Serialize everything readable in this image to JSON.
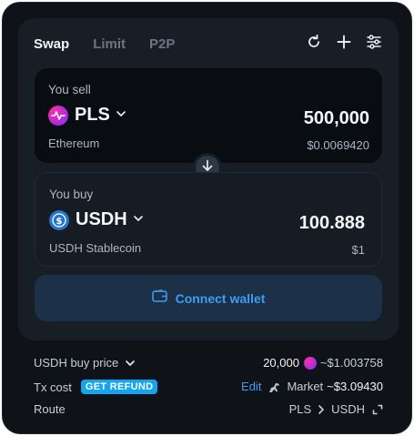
{
  "tabs": [
    {
      "label": "Swap"
    },
    {
      "label": "Limit"
    },
    {
      "label": "P2P"
    }
  ],
  "tool_icons": [
    "refresh-icon",
    "plus-icon",
    "sliders-icon"
  ],
  "sell": {
    "label": "You sell",
    "token": "PLS",
    "amount": "500,000",
    "chain": "Ethereum",
    "usd": "$0.0069420"
  },
  "buy": {
    "label": "You buy",
    "token": "USDH",
    "amount": "100.888",
    "chain": "USDH Stablecoin",
    "usd": "$1"
  },
  "connect_label": "Connect wallet",
  "info": {
    "price_label": "USDH buy price",
    "price_amount": "20,000",
    "price_usd": "~$1.003758",
    "tx_label": "Tx cost",
    "refund_label": "GET REFUND",
    "edit_label": "Edit",
    "mode_label": "Market",
    "tx_value": "~$3.09430",
    "route_label": "Route",
    "route_from": "PLS",
    "route_to": "USDH"
  },
  "colors": {
    "accent": "#3f9cf0",
    "refund_badge": "#15a5f0",
    "background": "#0f1318",
    "card": "#181e26"
  }
}
